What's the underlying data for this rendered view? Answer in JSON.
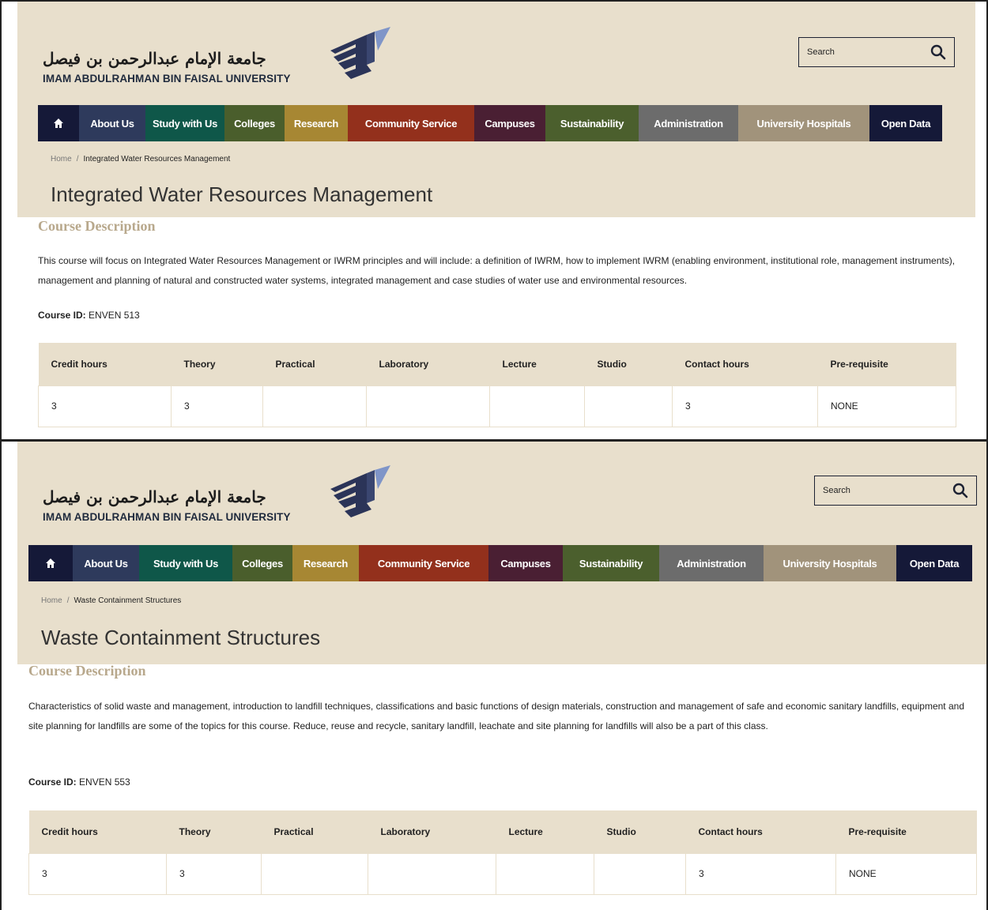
{
  "header": {
    "logo_arabic": "جامعة الإمام عبدالرحمن بن فيصل",
    "logo_english": "IMAM ABDULRAHMAN BIN FAISAL UNIVERSITY",
    "search_placeholder": "Search",
    "search_icon": "search-icon"
  },
  "nav": {
    "home_icon": "home-icon",
    "items": [
      {
        "label": "About Us",
        "color": "#2e3a5c"
      },
      {
        "label": "Study with Us",
        "color": "#0f5749"
      },
      {
        "label": "Colleges",
        "color": "#4a5e2c"
      },
      {
        "label": "Research",
        "color": "#a78733"
      },
      {
        "label": "Community Service",
        "color": "#93301c"
      },
      {
        "label": "Campuses",
        "color": "#4a1f33"
      },
      {
        "label": "Sustainability",
        "color": "#4b5f2d"
      },
      {
        "label": "Administration",
        "color": "#6c6c6c"
      },
      {
        "label": "University Hospitals",
        "color": "#a1937b"
      },
      {
        "label": "Open Data",
        "color": "#151938"
      }
    ],
    "home_color": "#151938"
  },
  "colors": {
    "header_bg": "#e8dfcc",
    "section_heading": "#b8a88c"
  },
  "table_headers": [
    "Credit hours",
    "Theory",
    "Practical",
    "Laboratory",
    "Lecture",
    "Studio",
    "Contact hours",
    "Pre-requisite"
  ],
  "pages": [
    {
      "breadcrumb_home": "Home",
      "breadcrumb_separator": "/",
      "breadcrumb_current": "Integrated Water Resources Management",
      "title": "Integrated Water Resources Management",
      "section_heading": "Course Description",
      "description": "This course will focus on Integrated Water Resources Management or IWRM principles and will include:  a definition of IWRM, how to implement IWRM (enabling environment, institutional role, management instruments), management and planning of natural and constructed water systems, integrated management and case studies of water use and environmental resources.",
      "course_id_label": "Course ID:",
      "course_id_value": " ENVEN 513",
      "row": [
        "3",
        "3",
        "",
        "",
        "",
        "",
        "3",
        "NONE"
      ]
    },
    {
      "breadcrumb_home": "Home",
      "breadcrumb_separator": "/",
      "breadcrumb_current": "Waste Containment Structures",
      "title": "Waste Containment Structures",
      "section_heading": "Course Description",
      "description": "Characteristics of solid waste and management, introduction to landfill techniques, classifications and basic functions of design materials, construction and management of safe and economic sanitary landfills, equipment and site planning for landfills are some of the topics for this course.  Reduce, reuse and recycle, sanitary landfill, leachate and site planning for landfills will also be a part of this class.",
      "course_id_label": "Course ID:",
      "course_id_value": " ENVEN 553",
      "row": [
        "3",
        "3",
        "",
        "",
        "",
        "",
        "3",
        "NONE"
      ]
    }
  ]
}
